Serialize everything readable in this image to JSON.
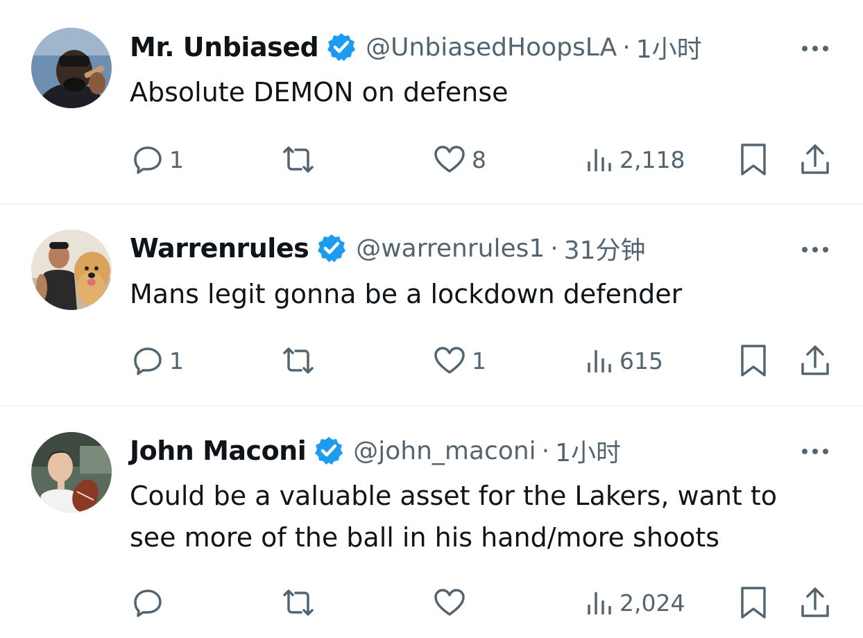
{
  "tweets": [
    {
      "name": "Mr. Unbiased",
      "handle": "@UnbiasedHoopsLA",
      "separator": "·",
      "time": "1小时",
      "text_lines": [
        "Absolute DEMON on defense"
      ],
      "reply_count": "1",
      "like_count": "8",
      "view_count": "2,118"
    },
    {
      "name": "Warrenrules",
      "handle": "@warrenrules1",
      "separator": "·",
      "time": "31分钟",
      "text_lines": [
        "Mans legit gonna be a lockdown defender"
      ],
      "reply_count": "1",
      "like_count": "1",
      "view_count": "615"
    },
    {
      "name": "John Maconi",
      "handle": "@john_maconi",
      "separator": "·",
      "time": "1小时",
      "text_lines": [
        "Could be a valuable asset for the Lakers, want to",
        "see more of the ball in his hand/more shoots"
      ],
      "reply_count": "",
      "like_count": "",
      "view_count": "2,024"
    }
  ],
  "icons": {
    "verified": "verified-badge-icon",
    "more": "more-icon",
    "reply": "reply-icon",
    "retweet": "retweet-icon",
    "like": "like-icon",
    "views": "views-icon",
    "bookmark": "bookmark-icon",
    "share": "share-icon"
  },
  "colors": {
    "verified_blue": "#1d9bf0",
    "text_primary": "#0f1419",
    "text_secondary": "#536471",
    "divider": "#eff3f4"
  }
}
